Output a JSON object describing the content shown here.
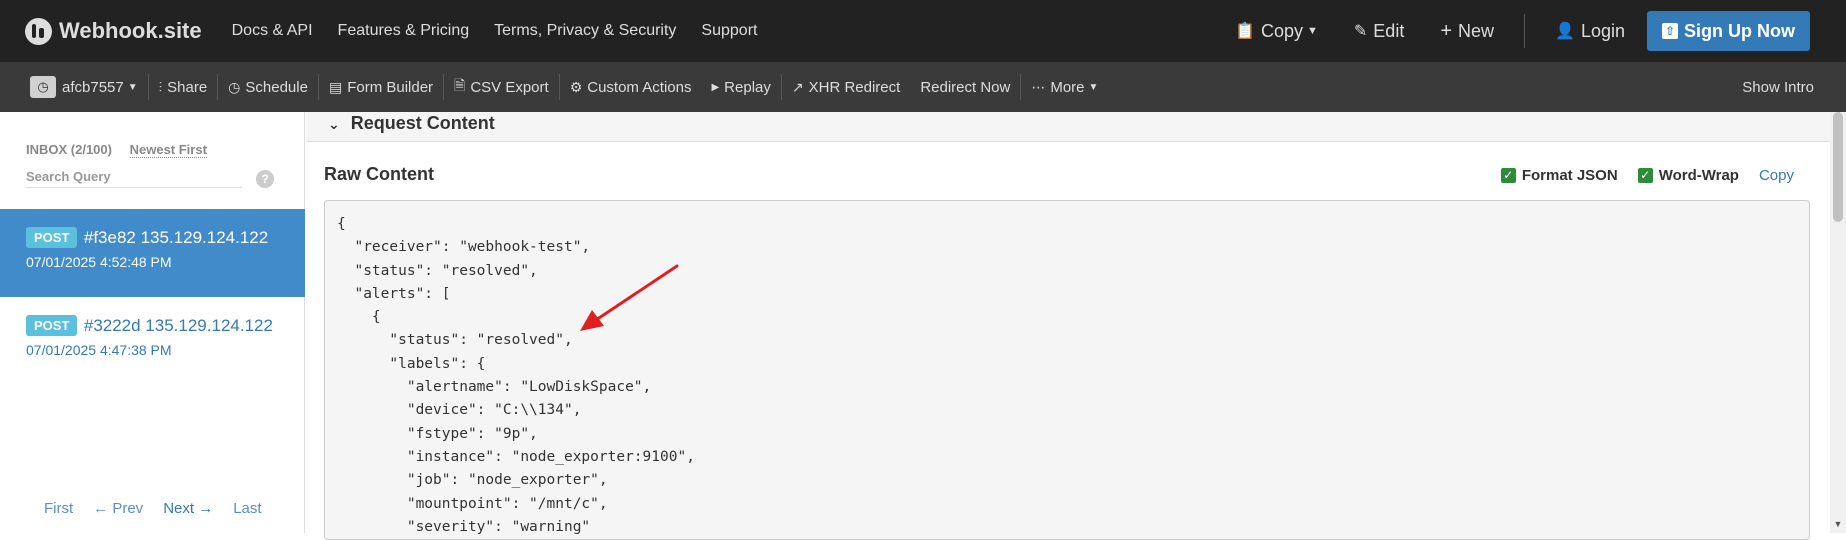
{
  "navbar": {
    "brand": "Webhook.site",
    "links": [
      "Docs & API",
      "Features & Pricing",
      "Terms, Privacy & Security",
      "Support"
    ],
    "copy": "Copy",
    "edit": "Edit",
    "new": "New",
    "login": "Login",
    "signup": "Sign Up Now"
  },
  "toolbar": {
    "token": "afcb7557",
    "share": "Share",
    "schedule": "Schedule",
    "form_builder": "Form Builder",
    "csv_export": "CSV Export",
    "custom_actions": "Custom Actions",
    "replay": "Replay",
    "xhr_redirect": "XHR Redirect",
    "redirect_now": "Redirect Now",
    "more": "More",
    "show_intro": "Show Intro"
  },
  "sidebar": {
    "inbox": "INBOX (2/100)",
    "sort": "Newest First",
    "search_placeholder": "Search Query",
    "help": "?",
    "requests": [
      {
        "method": "POST",
        "id": "#f3e82 135.129.124.122",
        "time": "07/01/2025 4:52:48 PM",
        "active": true
      },
      {
        "method": "POST",
        "id": "#3222d 135.129.124.122",
        "time": "07/01/2025 4:47:38 PM",
        "active": false
      }
    ],
    "pager": {
      "first": "First",
      "prev": "← Prev",
      "next": "Next →",
      "last": "Last"
    }
  },
  "main": {
    "section_title": "Request Content",
    "raw_title": "Raw Content",
    "format_json": "Format JSON",
    "word_wrap": "Word-Wrap",
    "copy": "Copy",
    "code_lines": [
      "{",
      "  \"receiver\": \"webhook-test\",",
      "  \"status\": \"resolved\",",
      "  \"alerts\": [",
      "    {",
      "      \"status\": \"resolved\",",
      "      \"labels\": {",
      "        \"alertname\": \"LowDiskSpace\",",
      "        \"device\": \"C:\\\\134\",",
      "        \"fstype\": \"9p\",",
      "        \"instance\": \"node_exporter:9100\",",
      "        \"job\": \"node_exporter\",",
      "        \"mountpoint\": \"/mnt/c\",",
      "        \"severity\": \"warning\""
    ]
  },
  "colors": {
    "navbar_bg": "#222222",
    "toolbar_bg": "#3a3a3a",
    "accent": "#337ab7",
    "active_request": "#428bca",
    "method_badge": "#5bc0de",
    "checkbox": "#2e8b3a",
    "annotation_arrow": "#e02020"
  }
}
